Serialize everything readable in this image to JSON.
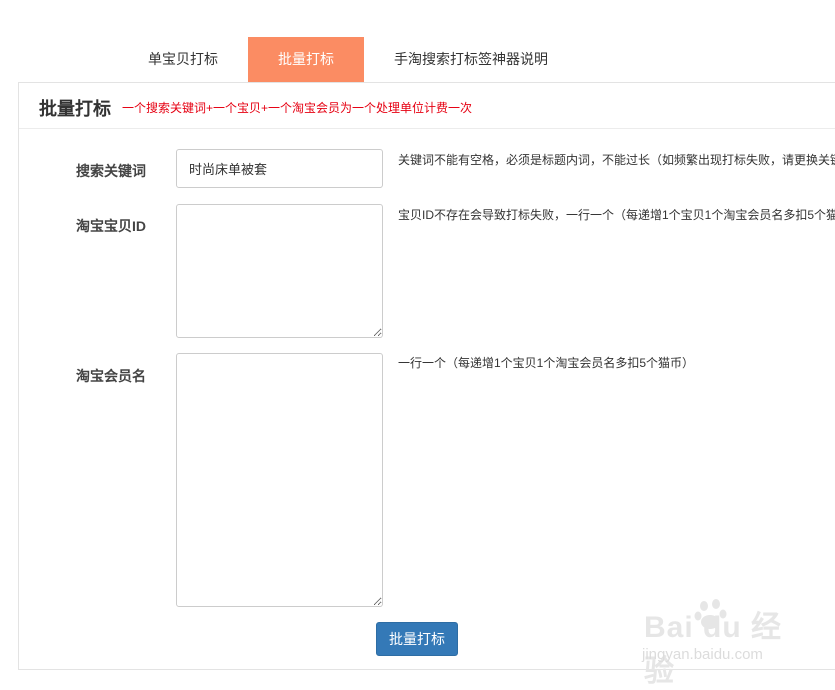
{
  "tabs": [
    {
      "label": "单宝贝打标",
      "active": false
    },
    {
      "label": "批量打标",
      "active": true
    },
    {
      "label": "手淘搜索打标签神器说明",
      "active": false
    }
  ],
  "panel": {
    "title": "批量打标",
    "note": "一个搜索关键词+一个宝贝+一个淘宝会员为一个处理单位计费一次"
  },
  "form": {
    "keyword": {
      "label": "搜索关键词",
      "value": "时尚床单被套",
      "hint": "关键词不能有空格，必须是标题内词，不能过长（如频繁出现打标失败，请更换关键"
    },
    "item_id": {
      "label": "淘宝宝贝ID",
      "value": "",
      "hint": "宝贝ID不存在会导致打标失败，一行一个（每递增1个宝贝1个淘宝会员名多扣5个猫"
    },
    "member": {
      "label": "淘宝会员名",
      "value": "",
      "hint": "一行一个（每递增1个宝贝1个淘宝会员名多扣5个猫币）"
    },
    "submit_label": "批量打标"
  },
  "watermark": {
    "main": "Bai du 经验",
    "sub": "jingyan.baidu.com"
  },
  "colors": {
    "active_tab": "#fb8c63",
    "note_red": "#e60012",
    "button_blue": "#3479b7"
  }
}
